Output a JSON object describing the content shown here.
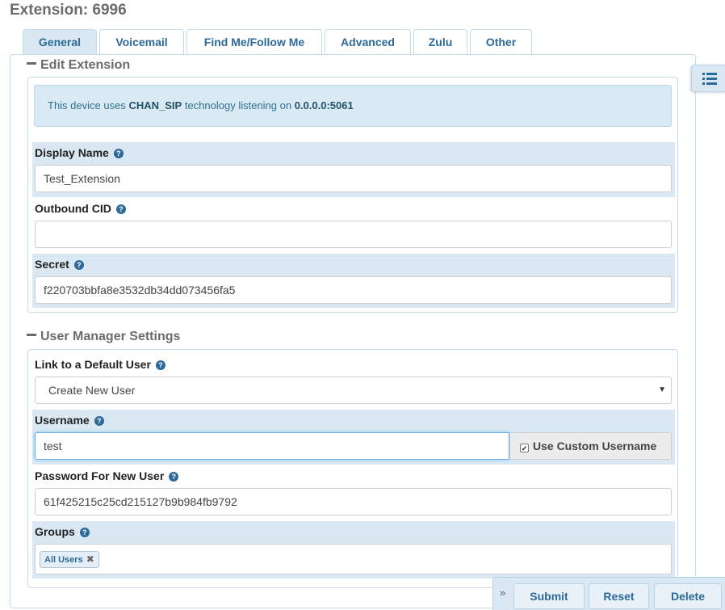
{
  "page": {
    "title": "Extension: 6996"
  },
  "tabs": [
    {
      "label": "General",
      "active": true
    },
    {
      "label": "Voicemail"
    },
    {
      "label": "Find Me/Follow Me"
    },
    {
      "label": "Advanced"
    },
    {
      "label": "Zulu"
    },
    {
      "label": "Other"
    }
  ],
  "edit_extension": {
    "heading": "Edit Extension",
    "info": {
      "prefix": "This device uses",
      "tech": "CHAN_SIP",
      "middle": "technology listening on",
      "address": "0.0.0.0:5061"
    },
    "display_name": {
      "label": "Display Name",
      "value": "Test_Extension"
    },
    "outbound_cid": {
      "label": "Outbound CID",
      "value": ""
    },
    "secret": {
      "label": "Secret",
      "value": "f220703bbfa8e3532db34dd073456fa5"
    }
  },
  "user_manager": {
    "heading": "User Manager Settings",
    "link_default_user": {
      "label": "Link to a Default User",
      "selected": "Create New User"
    },
    "username": {
      "label": "Username",
      "value": "test",
      "custom_label": "Use Custom Username",
      "custom_checked": true
    },
    "password": {
      "label": "Password For New User",
      "value": "61f425215c25cd215127b9b984fb9792"
    },
    "groups": {
      "label": "Groups",
      "tags": [
        "All Users"
      ]
    }
  },
  "actions": {
    "submit": "Submit",
    "reset": "Reset",
    "delete": "Delete"
  },
  "icons": {
    "help": "question-circle-icon",
    "list": "list-icon",
    "collapse": "minus-icon",
    "expand": "double-chevron-right-icon",
    "remove": "close-icon"
  },
  "colors": {
    "accent": "#2d6a9a",
    "highlight": "#d9e8f3",
    "info_bg": "#d9eaf4"
  }
}
